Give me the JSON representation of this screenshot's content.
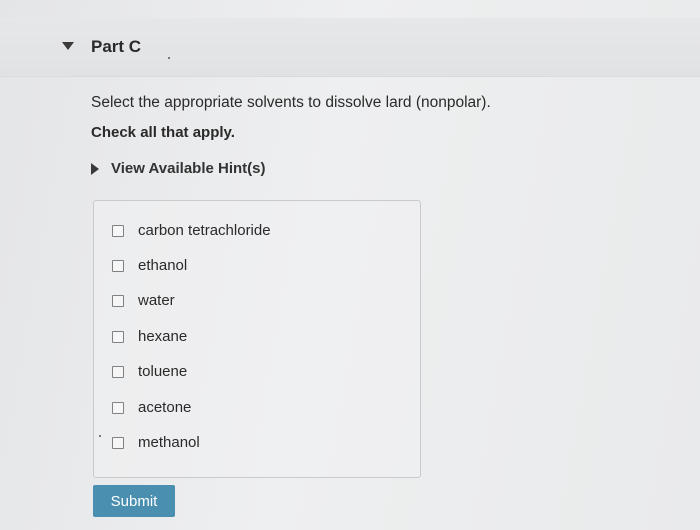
{
  "part": {
    "title": "Part C"
  },
  "question": {
    "text": "Select the appropriate solvents to dissolve lard (nonpolar).",
    "instruction": "Check all that apply."
  },
  "hint": {
    "label": "View Available Hint(s)"
  },
  "choices": [
    {
      "label": "carbon tetrachloride",
      "checked": false
    },
    {
      "label": "ethanol",
      "checked": false
    },
    {
      "label": "water",
      "checked": false
    },
    {
      "label": "hexane",
      "checked": false
    },
    {
      "label": "toluene",
      "checked": false
    },
    {
      "label": "acetone",
      "checked": false
    },
    {
      "label": "methanol",
      "checked": false
    }
  ],
  "submit": {
    "label": "Submit"
  },
  "colors": {
    "submit_bg": "#4a8fb0",
    "text": "#2a2a2a"
  }
}
